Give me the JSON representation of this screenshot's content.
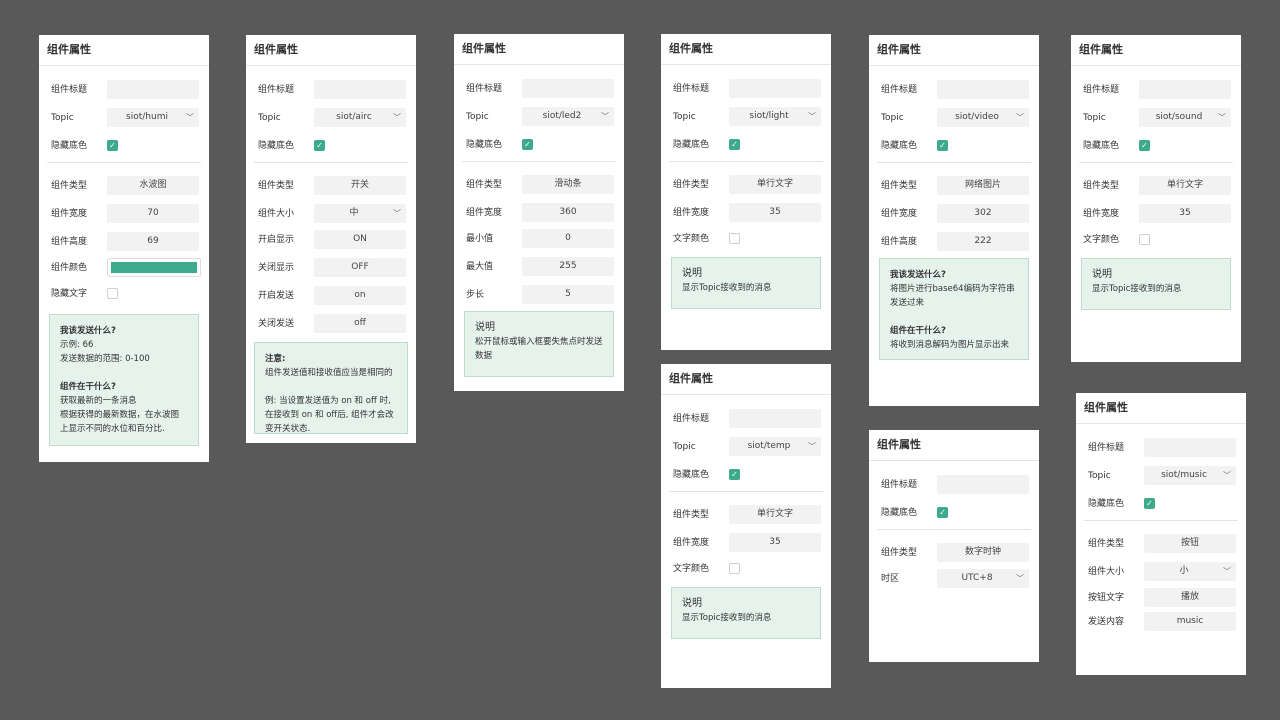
{
  "common": {
    "panel_title": "组件属性",
    "label_title": "组件标题",
    "label_topic": "Topic",
    "label_hide_bg": "隐藏底色",
    "label_type": "组件类型",
    "label_width": "组件宽度",
    "label_height": "组件高度",
    "label_color": "组件颜色",
    "label_hide_text": "隐藏文字",
    "label_size": "组件大小",
    "label_on_display": "开启显示",
    "label_off_display": "关闭显示",
    "label_on_send": "开启发送",
    "label_off_send": "关闭发送",
    "label_min": "最小值",
    "label_max": "最大值",
    "label_step": "步长",
    "label_text_color": "文字颜色",
    "label_timezone": "时区",
    "label_button_text": "按钮文字",
    "label_send_content": "发送内容",
    "note_title": "说明"
  },
  "accent_color": "#3daa8c",
  "icons": {
    "select": "chevron-down-icon",
    "checkbox": "check-icon"
  },
  "p1": {
    "topic": "siot/humi",
    "type": "水波图",
    "width": "70",
    "height": "69",
    "note_q1": "我该发送什么?",
    "note_l1": "示例: 66",
    "note_l2": "发送数据的范围: 0-100",
    "note_q2": "组件在干什么?",
    "note_l3": "获取最新的一条消息",
    "note_l4": "根据获得的最新数据，在水波图",
    "note_l5": "上显示不同的水位和百分比."
  },
  "p2": {
    "topic": "siot/airc",
    "type": "开关",
    "size": "中",
    "on_display": "ON",
    "off_display": "OFF",
    "on_send": "on",
    "off_send": "off",
    "note_head": "注意:",
    "note_l1": "组件发送值和接收值应当是相同的",
    "note_l2": "例: 当设置发送值为 on 和 off 时,",
    "note_l3": "在接收到 on 和 off后, 组件才会改",
    "note_l4": "变开关状态."
  },
  "p3": {
    "topic": "siot/led2",
    "type": "滑动条",
    "width": "360",
    "min": "0",
    "max": "255",
    "step": "5",
    "note_l1": "松开鼠标或输入框要失焦点时发送",
    "note_l2": "数据"
  },
  "p4": {
    "topic": "siot/light",
    "type": "单行文字",
    "width": "35",
    "note_l1": "显示Topic接收到的消息"
  },
  "p5": {
    "topic": "siot/temp",
    "type": "单行文字",
    "width": "35",
    "note_l1": "显示Topic接收到的消息"
  },
  "p6": {
    "topic": "siot/video",
    "type": "网络图片",
    "width": "302",
    "height": "222",
    "note_q1": "我该发送什么?",
    "note_l1": "将图片进行base64编码为字符串",
    "note_l2": "发送过来",
    "note_q2": "组件在干什么?",
    "note_l3": "将收到消息解码为图片显示出来"
  },
  "p7": {
    "type": "数字时钟",
    "timezone": "UTC+8"
  },
  "p8": {
    "topic": "siot/sound",
    "type": "单行文字",
    "width": "35",
    "note_l1": "显示Topic接收到的消息"
  },
  "p9": {
    "topic": "siot/music",
    "type": "按钮",
    "size": "小",
    "button_text": "播放",
    "send_content": "music"
  }
}
